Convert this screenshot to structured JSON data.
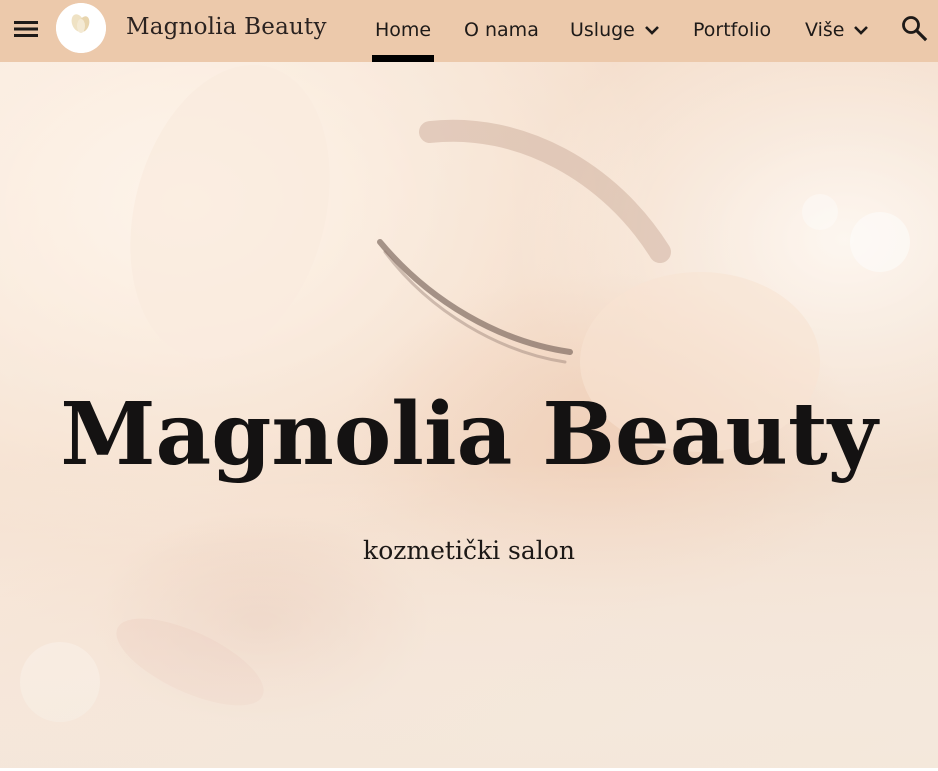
{
  "header": {
    "site_title": "Magnolia Beauty",
    "logo_text": "Magnolia",
    "logo_subtext": "beauty",
    "background_color": "#ecc9ab",
    "menu_icon": "hamburger-menu-icon",
    "search_icon": "search-icon"
  },
  "nav": {
    "items": [
      {
        "label": "Home",
        "active": true,
        "has_dropdown": false
      },
      {
        "label": "O nama",
        "active": false,
        "has_dropdown": false
      },
      {
        "label": "Usluge",
        "active": false,
        "has_dropdown": true
      },
      {
        "label": "Portfolio",
        "active": false,
        "has_dropdown": false
      },
      {
        "label": "Više",
        "active": false,
        "has_dropdown": true
      }
    ],
    "active_indicator_color": "#000000"
  },
  "hero": {
    "title": "Magnolia Beauty",
    "subtitle": "kozmetički salon",
    "image": "close-up of a woman with closed eyes receiving a facial treatment"
  }
}
